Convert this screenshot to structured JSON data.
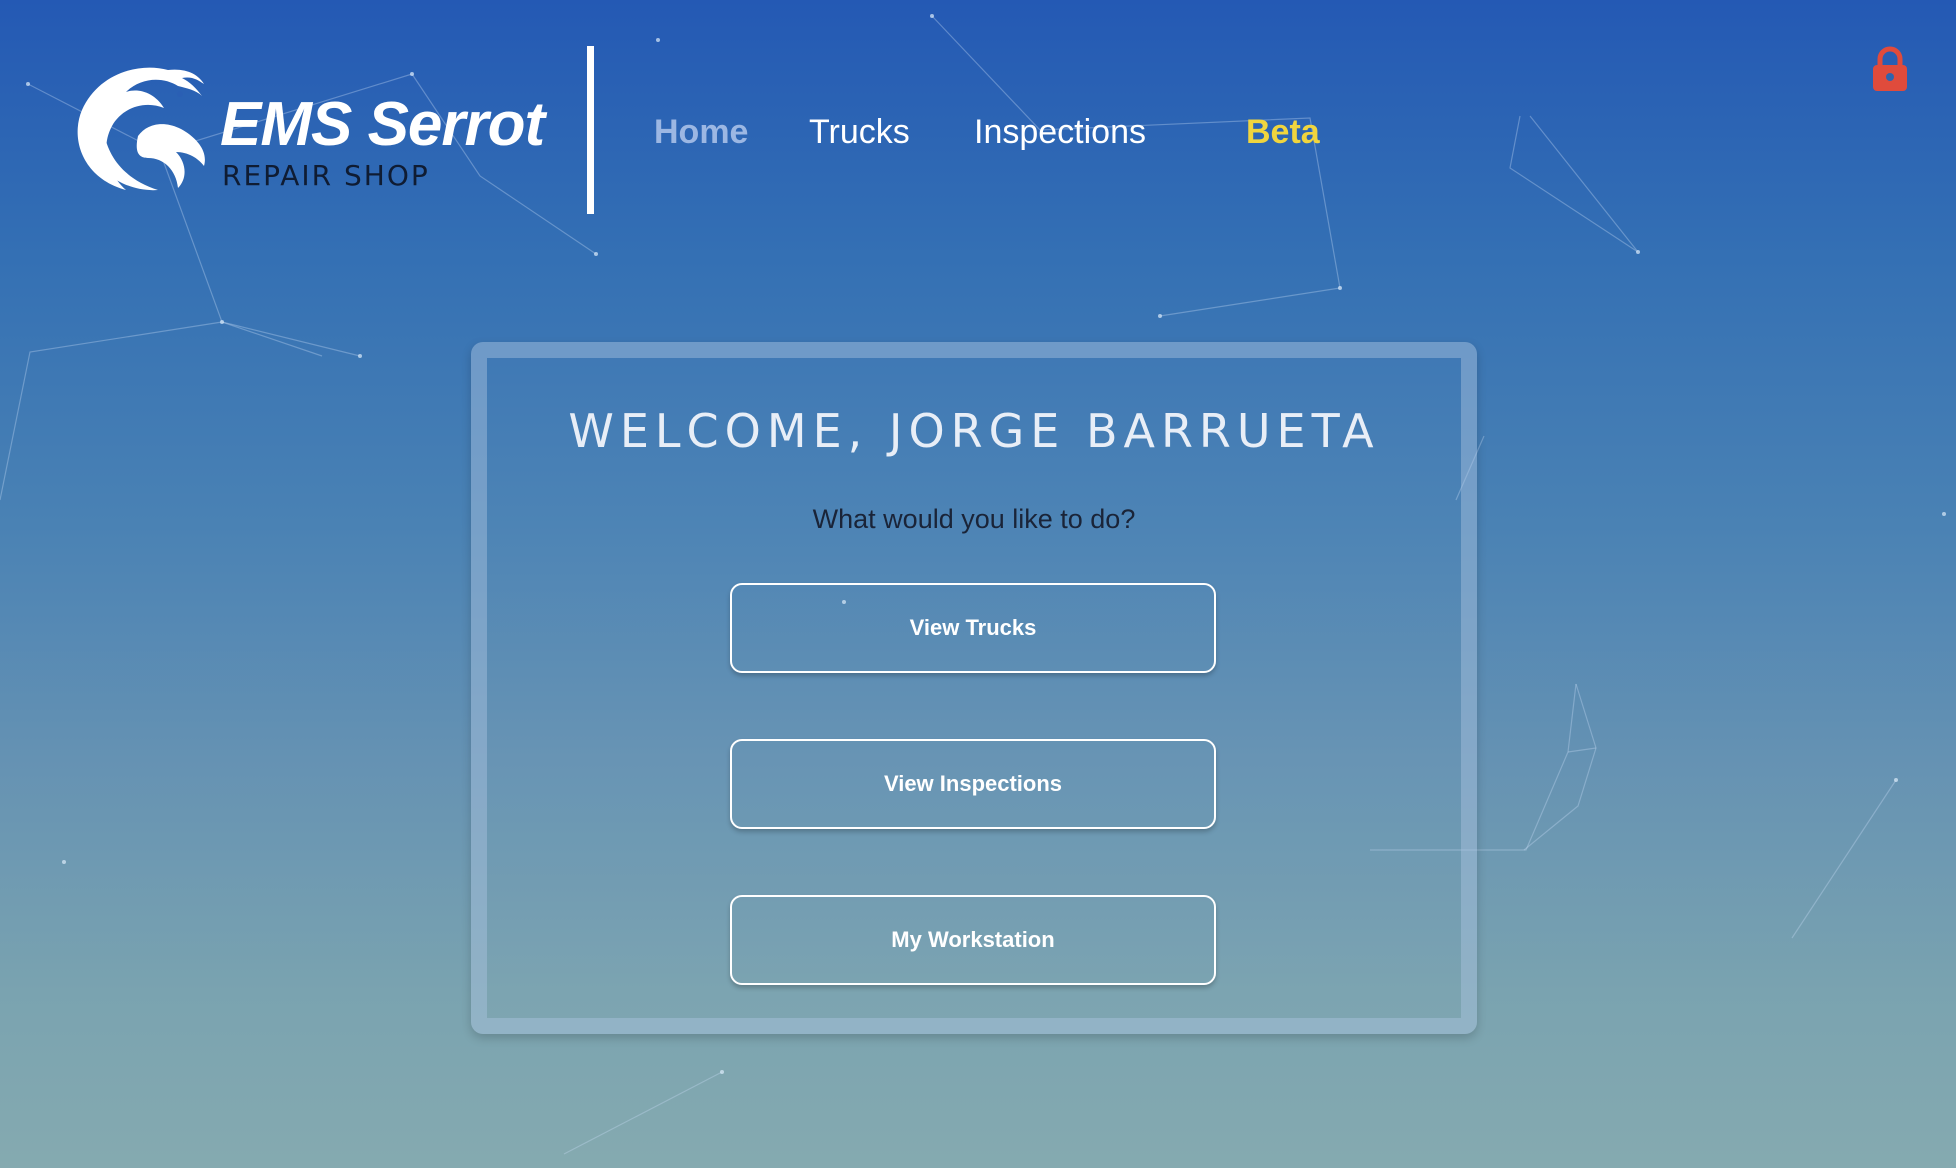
{
  "brand": {
    "title": "EMS Serrot",
    "subtitle": "REPAIR SHOP"
  },
  "nav": {
    "home": "Home",
    "trucks": "Trucks",
    "inspections": "Inspections",
    "beta": "Beta"
  },
  "header": {
    "lock_icon": "lock-icon"
  },
  "welcome": {
    "title": "Welcome, Jorge Barrueta",
    "prompt": "What would you like to do?"
  },
  "actions": {
    "view_trucks": "View Trucks",
    "view_inspections": "View Inspections",
    "my_workstation": "My Workstation"
  },
  "colors": {
    "accent_beta": "#f0d53e",
    "active_nav": "#9cb7e3",
    "lock": "#e04b3c",
    "background_top": "#2459b4",
    "background_bottom": "#85aab0"
  }
}
